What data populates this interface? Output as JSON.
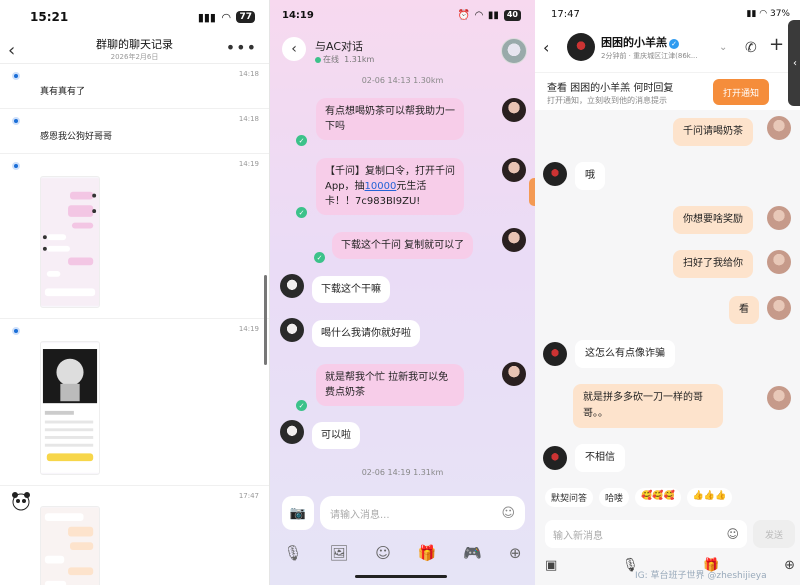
{
  "panel1": {
    "status": {
      "time": "15:21",
      "battery": "77"
    },
    "nav": {
      "title": "群聊的聊天记录",
      "date": "2026年2月6日"
    },
    "records": [
      {
        "time": "14:18",
        "text": "真有真有了"
      },
      {
        "time": "14:18",
        "text": "感恩我公狗好哥哥"
      },
      {
        "time": "14:19",
        "text": ""
      },
      {
        "time": "14:19",
        "text": ""
      },
      {
        "time": "17:47",
        "text": ""
      }
    ]
  },
  "panel2": {
    "status": {
      "time": "14:19",
      "battery": "40"
    },
    "header": {
      "name": "与AC对话",
      "status_label": "在线",
      "distance": "1.31km"
    },
    "stamps": [
      "02-06 14:13 1.30km",
      "02-06 14:19 1.31km"
    ],
    "messages": [
      {
        "dir": "out",
        "text": "有点想喝奶茶可以帮我助力一下吗"
      },
      {
        "dir": "out",
        "text_before": "【千问】复制口令，打开千问App，抽",
        "link": "10000",
        "text_after": "元生活卡！！7c983BI9ZU!"
      },
      {
        "dir": "out",
        "text": "下载这个千问 复制就可以了"
      },
      {
        "dir": "in",
        "text": "下载这个干嘛"
      },
      {
        "dir": "in",
        "text": "喝什么我请你就好啦"
      },
      {
        "dir": "out",
        "text": "就是帮我个忙 拉新我可以免费点奶茶"
      },
      {
        "dir": "in",
        "text": "可以啦"
      }
    ],
    "input": {
      "placeholder": "请输入消息..."
    }
  },
  "panel3": {
    "status": {
      "time": "17:47",
      "battery": "37%"
    },
    "header": {
      "name": "困困的小羊羔",
      "sub": "2分钟前 · 重庆城区江津(86k..."
    },
    "notice": {
      "title": "查看 困困的小羊羔 何时回复",
      "sub": "打开通知，立刻收到他的消息提示",
      "button": "打开通知"
    },
    "messages": [
      {
        "dir": "out",
        "text": "千问请喝奶茶"
      },
      {
        "dir": "in",
        "text": "哦"
      },
      {
        "dir": "out",
        "text": "你想要啥奖励"
      },
      {
        "dir": "out",
        "text": "扫好了我给你"
      },
      {
        "dir": "out",
        "text": "看"
      },
      {
        "dir": "in",
        "text": "这怎么有点像诈骗"
      },
      {
        "dir": "out",
        "text": "就是拼多多砍一刀一样的哥哥。。"
      },
      {
        "dir": "in",
        "text": "不相信"
      }
    ],
    "chips": [
      "默契问答",
      "哈喽",
      "🥰🥰🥰",
      "👍👍👍"
    ],
    "input": {
      "placeholder": "输入新消息",
      "send": "发送"
    },
    "watermark": "IG: 草台班子世界 @zheshijieya"
  }
}
